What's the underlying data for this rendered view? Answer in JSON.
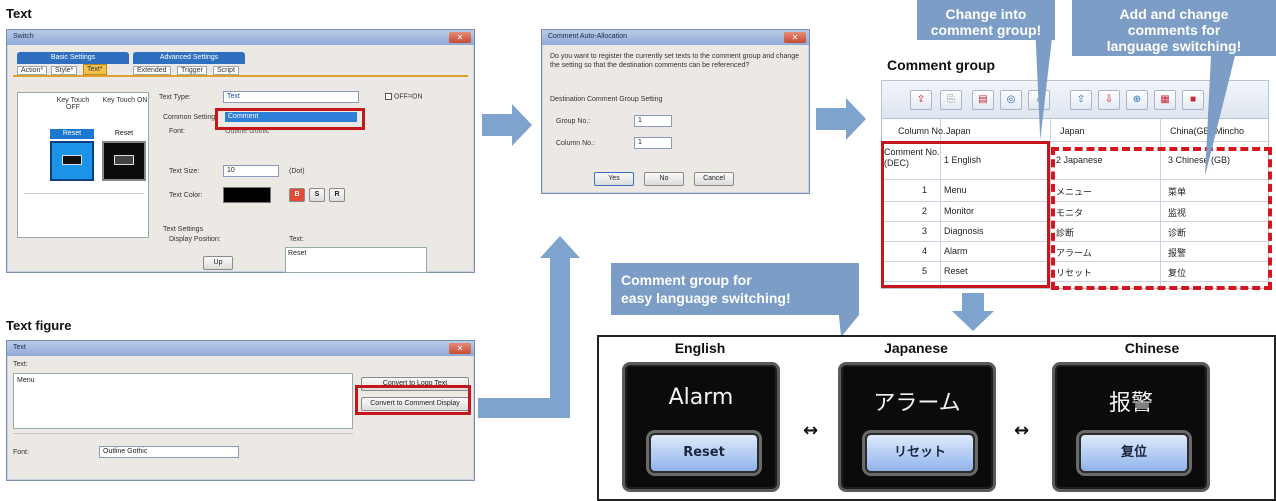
{
  "sections": {
    "text_title": "Text",
    "text_figure_title": "Text figure",
    "comment_group_title": "Comment group"
  },
  "callouts": {
    "change_into": "Change into\ncomment group!",
    "add_change": "Add and change\ncomments for\nlanguage switching!",
    "easy_switch": "Comment group for\neasy language switching!"
  },
  "switch_dialog": {
    "title": "Switch",
    "group_basic": "Basic Settings",
    "group_advanced": "Advanced Settings",
    "tabs": [
      "Action*",
      "Style*",
      "Text*",
      "Extended",
      "Trigger",
      "Script"
    ],
    "col_off": "Key Touch OFF",
    "col_on": "Key Touch ON",
    "preview_off": "Reset",
    "preview_on": "Reset",
    "text_type_label": "Text Type:",
    "text_type_value": "Text",
    "checkbox_label": "OFF=ON",
    "common_setting_label": "Common Setting",
    "dropdown_option": "Comment",
    "font_label": "Font:",
    "font_value": "Outline Gothic",
    "text_size_label": "Text Size:",
    "text_size_value": "10",
    "text_size_unit": "(Dot)",
    "text_color_label": "Text Color:",
    "style_b": "B",
    "style_s": "S",
    "style_r": "R",
    "text_settings_label": "Text Settings",
    "display_position_label": "Display Position:",
    "text_label": "Text:",
    "text_value": "Reset",
    "up_button": "Up"
  },
  "confirm_dialog": {
    "title": "Comment Auto-Allocation",
    "message": "Do you want to register the currently set texts to the comment group and change the setting so that the destination comments can be referenced?",
    "dest_label": "Destination Comment Group Setting",
    "group_no_label": "Group No.:",
    "group_no_value": "1",
    "column_no_label": "Column No.:",
    "column_no_value": "1",
    "yes": "Yes",
    "no": "No",
    "cancel": "Cancel"
  },
  "text_figure_dialog": {
    "title": "Text",
    "text_label": "Text:",
    "text_value": "Menu",
    "convert_logo": "Convert to Logo Text",
    "convert_comment": "Convert to Comment Display",
    "font_label": "Font:",
    "font_value": "Outline Gothic"
  },
  "comment_sheet": {
    "headers": [
      "Column No.",
      "Japan",
      "Japan",
      "China(GB) Mincho"
    ],
    "comment_no_label": "Comment No.\n(DEC)",
    "column_titles": [
      "1 English",
      "2 Japanese",
      "3 Chinese (GB)"
    ],
    "rows": [
      {
        "no": "1",
        "en": "Menu",
        "ja": "メニュー",
        "zh": "菜单"
      },
      {
        "no": "2",
        "en": "Monitor",
        "ja": "モニタ",
        "zh": "监视"
      },
      {
        "no": "3",
        "en": "Diagnosis",
        "ja": "診断",
        "zh": "诊断"
      },
      {
        "no": "4",
        "en": "Alarm",
        "ja": "アラーム",
        "zh": "报警"
      },
      {
        "no": "5",
        "en": "Reset",
        "ja": "リセット",
        "zh": "复位"
      }
    ]
  },
  "panels": [
    {
      "label": "English",
      "word": "Alarm",
      "button": "Reset"
    },
    {
      "label": "Japanese",
      "word": "アラーム",
      "button": "リセット"
    },
    {
      "label": "Chinese",
      "word": "报警",
      "button": "复位"
    }
  ],
  "switch_arrow": "↔"
}
